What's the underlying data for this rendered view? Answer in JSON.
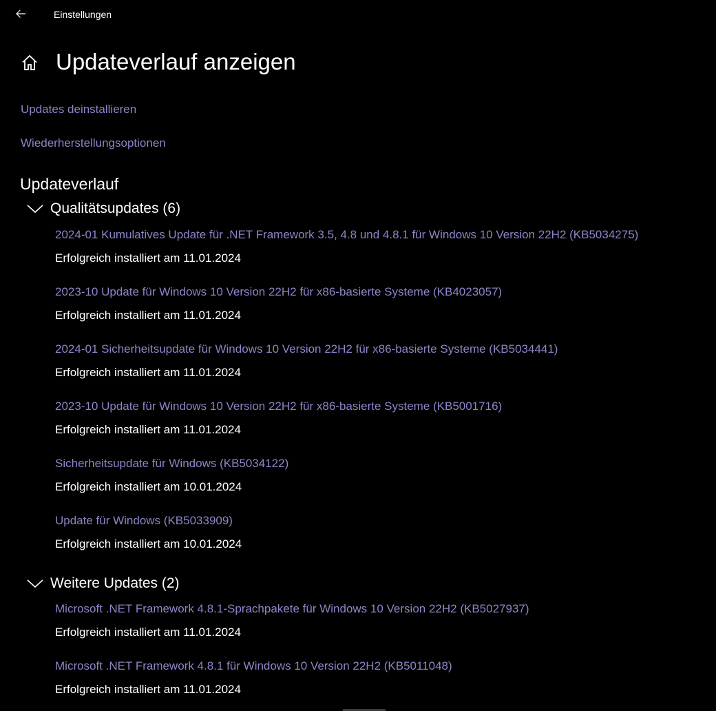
{
  "window": {
    "title": "Einstellungen",
    "back_icon": "back-arrow-icon"
  },
  "page": {
    "title": "Updateverlauf anzeigen",
    "home_icon": "home-icon"
  },
  "links": {
    "uninstall": "Updates deinstallieren",
    "recovery": "Wiederherstellungsoptionen"
  },
  "history": {
    "title": "Updateverlauf",
    "groups": [
      {
        "label": "Qualitätsupdates (6)",
        "expanded": true,
        "items": [
          {
            "name": "2024-01 Kumulatives Update für .NET Framework 3.5, 4.8 und 4.8.1 für Windows 10 Version 22H2 (KB5034275)",
            "status": "Erfolgreich installiert am 11.01.2024"
          },
          {
            "name": "2023-10 Update für Windows 10 Version 22H2 für x86-basierte Systeme (KB4023057)",
            "status": "Erfolgreich installiert am 11.01.2024"
          },
          {
            "name": "2024-01 Sicherheitsupdate für Windows 10 Version 22H2 für x86-basierte Systeme (KB5034441)",
            "status": "Erfolgreich installiert am 11.01.2024"
          },
          {
            "name": "2023-10 Update für Windows 10 Version 22H2 für x86-basierte Systeme (KB5001716)",
            "status": "Erfolgreich installiert am 11.01.2024"
          },
          {
            "name": "Sicherheitsupdate für Windows (KB5034122)",
            "status": "Erfolgreich installiert am 10.01.2024"
          },
          {
            "name": "Update für Windows (KB5033909)",
            "status": "Erfolgreich installiert am 10.01.2024"
          }
        ]
      },
      {
        "label": "Weitere Updates (2)",
        "expanded": true,
        "items": [
          {
            "name": "Microsoft .NET Framework 4.8.1-Sprachpakete für Windows 10 Version 22H2 (KB5027937)",
            "status": "Erfolgreich installiert am 11.01.2024"
          },
          {
            "name": "Microsoft .NET Framework 4.8.1 für Windows 10 Version 22H2 (KB5011048)",
            "status": "Erfolgreich installiert am 11.01.2024"
          }
        ]
      }
    ]
  },
  "colors": {
    "background": "#000000",
    "text": "#ffffff",
    "link": "#8a86c8"
  }
}
